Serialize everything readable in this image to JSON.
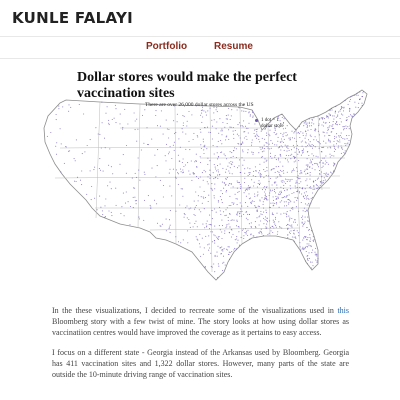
{
  "site": {
    "title": "KUNLE FALAYI"
  },
  "nav": [
    {
      "label": "Portfolio"
    },
    {
      "label": "Resume"
    }
  ],
  "map": {
    "title": "Dollar stores would make the perfect vaccination sites",
    "subtitle": "There are over 26,000 dollar stores across the US",
    "legend_label": "1 dot = 1 dollar store",
    "dot_color": "#6b55b5",
    "border_color": "#bbbbbb"
  },
  "article": {
    "p1_before": "In the these visualizations, I decided to recreate some of the visualizations used in",
    "p1_link": "this",
    "p1_after": "Bloomberg story with a few twist of mine. The story looks at how using dollar stores as vaccinatiion centres would have improved the coverage as it pertains to easy access.",
    "p2": "I focus on a different state - Georgia instead of the Arkansas used by Bloomberg. Georgia has 411 vaccination sites and 1,322 dollar stores. However, many parts of the state are outside the 10-minute driving range of vaccination sites."
  }
}
